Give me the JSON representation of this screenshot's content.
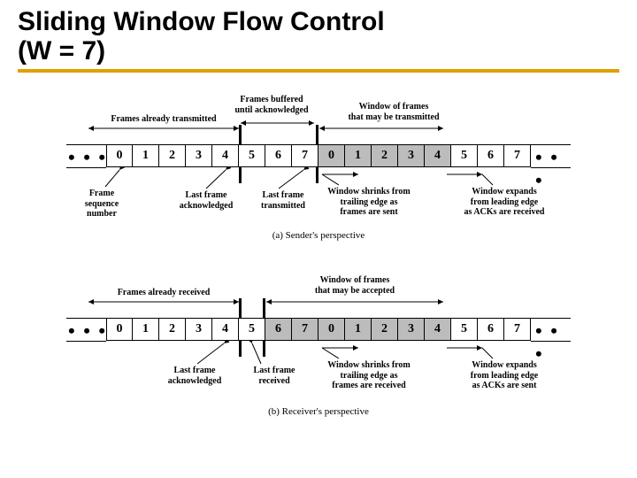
{
  "title_line1": "Sliding Window Flow Control",
  "title_line2": "(W = 7)",
  "sender": {
    "top_labels": {
      "transmitted": "Frames already transmitted",
      "buffered": "Frames buffered\nuntil acknowledged",
      "window": "Window of frames\nthat may be transmitted"
    },
    "cells": [
      "0",
      "1",
      "2",
      "3",
      "4",
      "5",
      "6",
      "7",
      "0",
      "1",
      "2",
      "3",
      "4",
      "5",
      "6",
      "7"
    ],
    "shaded_start": 8,
    "shaded_end": 12,
    "bottom_labels": {
      "seq": "Frame\nsequence\nnumber",
      "lastack": "Last frame\nacknowledged",
      "lasttx": "Last frame\ntransmitted",
      "shrink": "Window shrinks from\ntrailing edge as\nframes are sent",
      "expand": "Window expands\nfrom leading edge\nas ACKs are received"
    },
    "caption": "(a) Sender's perspective"
  },
  "receiver": {
    "top_labels": {
      "received": "Frames already received",
      "window": "Window of frames\nthat may be accepted"
    },
    "cells": [
      "0",
      "1",
      "2",
      "3",
      "4",
      "5",
      "6",
      "7",
      "0",
      "1",
      "2",
      "3",
      "4",
      "5",
      "6",
      "7"
    ],
    "shaded_start": 6,
    "shaded_end": 12,
    "bottom_labels": {
      "lastack": "Last frame\nacknowledged",
      "lastrx": "Last frame\nreceived",
      "shrink": "Window shrinks from\ntrailing edge as\nframes are received",
      "expand": "Window expands\nfrom leading edge\nas ACKs are sent"
    },
    "caption": "(b) Receiver's perspective"
  },
  "dots": "• • •"
}
